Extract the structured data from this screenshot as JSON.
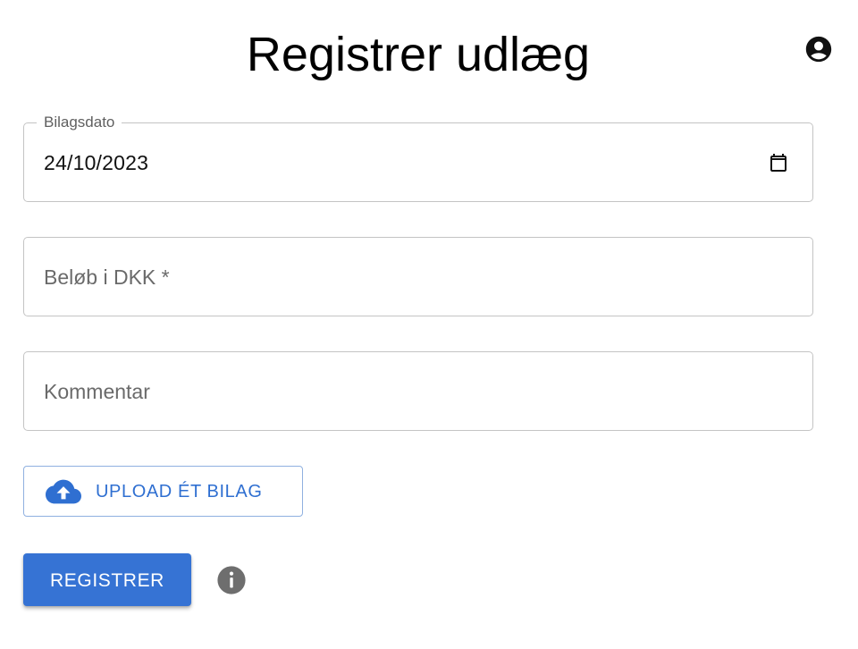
{
  "header": {
    "title": "Registrer udlæg",
    "account_icon": "account-circle-icon"
  },
  "form": {
    "date_field": {
      "label": "Bilagsdato",
      "value": "24/10/2023",
      "icon": "calendar-icon"
    },
    "amount_field": {
      "placeholder": "Beløb i DKK *",
      "value": ""
    },
    "comment_field": {
      "placeholder": "Kommentar",
      "value": ""
    },
    "upload_button": {
      "label": "UPLOAD ÉT BILAG",
      "icon": "cloud-upload-icon"
    },
    "submit_button": {
      "label": "REGISTRER"
    },
    "info_icon": "info-icon"
  },
  "colors": {
    "primary": "#3673d4",
    "outline_button_text": "#2f6fd1",
    "border": "#c4c4c4",
    "icon_gray": "#6e6e6e"
  }
}
